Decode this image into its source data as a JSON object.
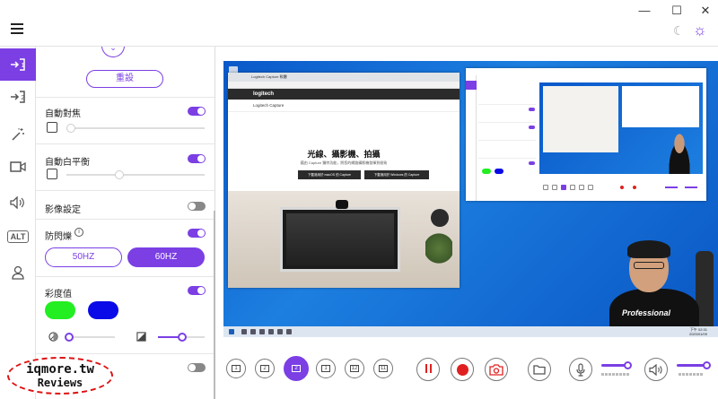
{
  "window": {
    "menu_icon": "hamburger-icon",
    "minimize_glyph": "—",
    "maximize_glyph": "☐",
    "close_glyph": "✕",
    "theme_dark_glyph": "☾",
    "theme_light_glyph": "☼"
  },
  "rail": {
    "items": [
      {
        "icon": "layout-1-icon",
        "glyph": "⇥1",
        "active": true
      },
      {
        "icon": "layout-2-icon",
        "glyph": "⇥2",
        "active": false
      },
      {
        "icon": "magic-wand-icon",
        "glyph": "✦",
        "active": false
      },
      {
        "icon": "video-camera-icon",
        "glyph": "▭",
        "active": false
      },
      {
        "icon": "speaker-icon",
        "glyph": "🔈",
        "active": false
      },
      {
        "icon": "alt-text-icon",
        "glyph": "ALT",
        "active": false
      },
      {
        "icon": "user-icon",
        "glyph": "⚲",
        "active": false
      }
    ]
  },
  "settings": {
    "collapse_glyph": "⌄",
    "reset_label": "重設",
    "autofocus_label": "自動對焦",
    "autofocus_on": true,
    "autofocus_level": 0.0,
    "auto_wb_label": "自動白平衡",
    "auto_wb_on": true,
    "auto_wb_level": 0.5,
    "image_settings_label": "影像設定",
    "image_settings_on": false,
    "antiflicker_label": "防閃爍",
    "antiflicker_on": true,
    "hz50_label": "50HZ",
    "hz60_label": "60HZ",
    "selected_hz": "60HZ",
    "saturation_label": "彩度值",
    "saturation_on": true,
    "swatch_green": "#22ee22",
    "swatch_blue": "#0a0ae8",
    "slider_left_level": 0.0,
    "slider_right_level": 0.55,
    "bottom_toggle_on": false
  },
  "preview": {
    "browser_tab": "Logitech Capture 軟體",
    "site_logo": "logitech",
    "site_nav": "Logitech Capture",
    "site_headline": "光線、攝影機、拍攝",
    "site_sub": "藉由 Capture 獨特功能，將您的網路攝影機發揮到極致",
    "dl_mac": "下載適用於 macOS 的 Capture",
    "dl_win": "下載適用於 Windows 的 Capture",
    "person_shirt_text": "Professional",
    "taskbar_time": "下午 02:31",
    "taskbar_date": "2020/01/09"
  },
  "toolbar": {
    "layout_buttons": [
      "1",
      "2",
      "2+1",
      "1+1",
      "1|2",
      "1|1"
    ],
    "active_layout": 2,
    "mic_level": 1.0,
    "speaker_level": 1.0
  },
  "watermark": {
    "line1": "iqmore.tw",
    "line2": "Reviews"
  },
  "colors": {
    "accent": "#7b3fe4",
    "record": "#e02020"
  }
}
